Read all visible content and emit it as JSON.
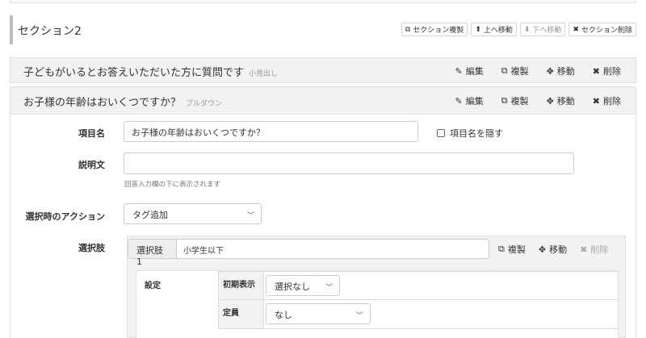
{
  "section": {
    "title": "セクション2",
    "buttons": [
      {
        "label": "セクション複製",
        "icon": "copy-icon"
      },
      {
        "label": "上へ移動",
        "icon": "arrow-up-icon"
      },
      {
        "label": "下へ移動",
        "icon": "arrow-down-icon",
        "disabled": true
      },
      {
        "label": "セクション削除",
        "icon": "close-icon"
      }
    ]
  },
  "actions": {
    "edit": "編集",
    "copy": "複製",
    "move": "移動",
    "delete": "削除"
  },
  "heading_row": {
    "title": "子どもがいるとお答えいただいた方に質問です",
    "type": "小見出し"
  },
  "question_row": {
    "title": "お子様の年齢はおいくつですか？",
    "type": "プルダウン"
  },
  "form": {
    "item_name_label": "項目名",
    "item_name_value": "お子様の年齢はおいくつですか？",
    "hide_name_label": "項目名を隠す",
    "description_label": "説明文",
    "description_value": "",
    "description_hint": "回答入力欄の下に表示されます",
    "action_label": "選択時のアクション",
    "action_value": "タグ追加",
    "choices_label": "選択肢"
  },
  "choice": {
    "label": "選択肢1",
    "value": "小学生以下",
    "settings_label": "設定",
    "rows": [
      {
        "key": "初期表示",
        "value": "選択なし"
      },
      {
        "key": "定員",
        "value": "なし"
      }
    ]
  },
  "colors": {
    "panel_bg": "#f2f2f2",
    "border": "#e2e2e2",
    "section_bar": "#bdbdbd"
  }
}
